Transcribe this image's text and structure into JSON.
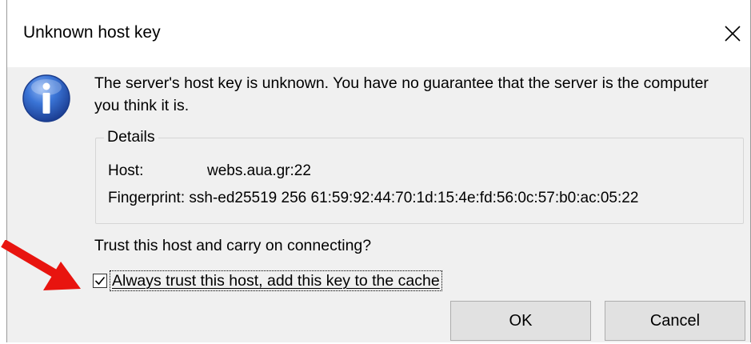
{
  "dialog": {
    "title": "Unknown host key",
    "close_glyph": "✕",
    "icon": "information-icon",
    "message": "The server's host key is unknown. You have no guarantee that the server is the computer you think it is.",
    "details": {
      "legend": "Details",
      "host_label": "Host:",
      "host_value": "webs.aua.gr:22",
      "fingerprint_label": "Fingerprint:",
      "fingerprint_value": "ssh-ed25519 256 61:59:92:44:70:1d:15:4e:fd:56:0c:57:b0:ac:05:22"
    },
    "question": "Trust this host and carry on connecting?",
    "checkbox": {
      "label": "Always trust this host, add this key to the cache",
      "checked": true
    },
    "buttons": {
      "ok": "OK",
      "cancel": "Cancel"
    }
  },
  "annotation": {
    "arrow_color": "#e8140f",
    "icon": "red-arrow-icon"
  },
  "colors": {
    "dialog_background": "#f0f0f0",
    "titlebar_background": "#ffffff",
    "button_background": "#e1e1e1",
    "info_icon_blue": "#2b63c6"
  }
}
